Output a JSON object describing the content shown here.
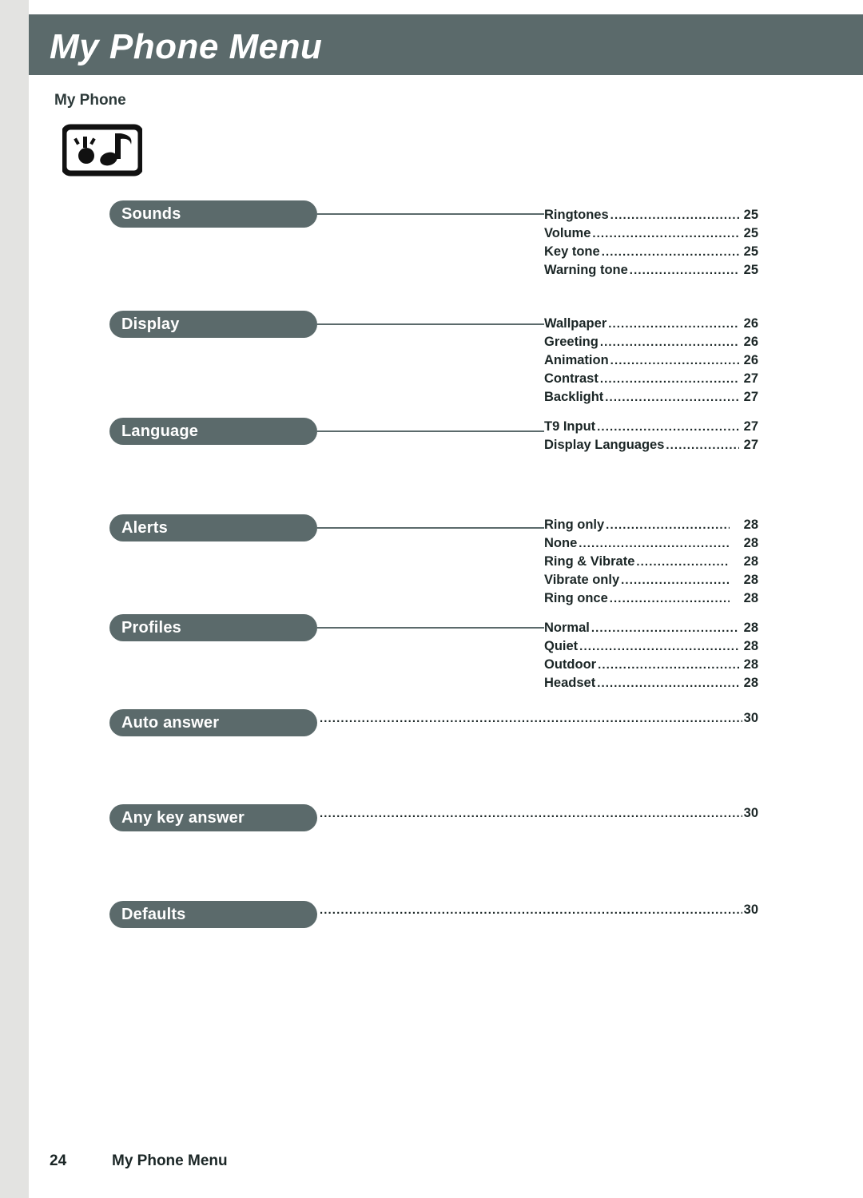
{
  "page": {
    "header_title": "My Phone Menu",
    "section_subtitle": "My Phone",
    "icon_name": "phone-with-note-icon",
    "footer_page_number": "24",
    "footer_title": "My Phone Menu",
    "accent_color": "#5b6a6b",
    "margin_color": "#e3e3e1"
  },
  "menu": [
    {
      "label": "Sounds",
      "items": [
        {
          "label": "Ringtones",
          "page": "25"
        },
        {
          "label": "Volume",
          "page": "25"
        },
        {
          "label": "Key tone",
          "page": "25"
        },
        {
          "label": "Warning tone",
          "page": "25"
        }
      ]
    },
    {
      "label": "Display",
      "items": [
        {
          "label": "Wallpaper",
          "page": "26"
        },
        {
          "label": "Greeting",
          "page": "26"
        },
        {
          "label": "Animation",
          "page": "26"
        },
        {
          "label": "Contrast",
          "page": "27"
        },
        {
          "label": "Backlight",
          "page": "27"
        }
      ]
    },
    {
      "label": "Language",
      "items": [
        {
          "label": "T9 Input",
          "page": "27"
        },
        {
          "label": "Display Languages",
          "page": "27"
        }
      ]
    },
    {
      "label": "Alerts",
      "items": [
        {
          "label": "Ring only",
          "page": "28"
        },
        {
          "label": "None",
          "page": "28"
        },
        {
          "label": "Ring & Vibrate",
          "page": "28"
        },
        {
          "label": "Vibrate only",
          "page": "28"
        },
        {
          "label": "Ring once",
          "page": "28"
        }
      ]
    },
    {
      "label": "Profiles",
      "items": [
        {
          "label": "Normal",
          "page": "28"
        },
        {
          "label": "Quiet",
          "page": "28"
        },
        {
          "label": "Outdoor",
          "page": "28"
        },
        {
          "label": "Headset",
          "page": "28"
        }
      ]
    },
    {
      "label": "Auto answer",
      "page": "30",
      "items": []
    },
    {
      "label": "Any key answer",
      "page": "30",
      "items": []
    },
    {
      "label": "Defaults",
      "page": "30",
      "items": []
    }
  ],
  "dots": {
    "short": "........................................................................",
    "long": "................................................................................................................................................................"
  }
}
